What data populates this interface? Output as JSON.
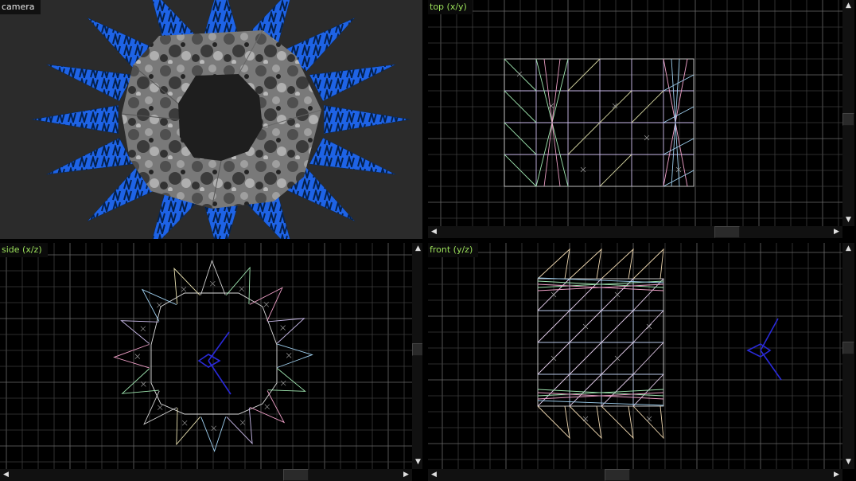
{
  "viewports": {
    "camera": {
      "label": "camera"
    },
    "top": {
      "label": "top (x/y)"
    },
    "side": {
      "label": "side (x/z)"
    },
    "front": {
      "label": "front (y/z)"
    }
  },
  "scrollbars": {
    "up_glyph": "▲",
    "down_glyph": "▼",
    "left_glyph": "◀",
    "right_glyph": "▶"
  },
  "colors": {
    "background": "#000000",
    "grid_minor": "#3c3c3c",
    "grid_major": "#6a6a6a",
    "label_ortho": "#9be05a",
    "entity_blue": "#2a2ad8",
    "texture_blue": "#1e63e6"
  }
}
